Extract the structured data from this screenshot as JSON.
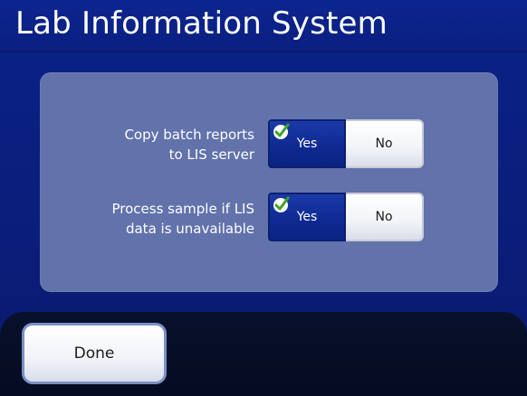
{
  "header": {
    "title": "Lab Information System"
  },
  "settings": {
    "rows": [
      {
        "label_line1": "Copy batch reports",
        "label_line2": "to LIS server",
        "yes_label": "Yes",
        "no_label": "No",
        "selected": "Yes"
      },
      {
        "label_line1": "Process sample if LIS",
        "label_line2": "data is unavailable",
        "yes_label": "Yes",
        "no_label": "No",
        "selected": "Yes"
      }
    ]
  },
  "footer": {
    "done_label": "Done"
  },
  "colors": {
    "selected_blue": "#0f2a93",
    "check_green": "#4caf2a",
    "panel": "#6272ab",
    "background": "#0b1f84"
  },
  "icons": {
    "selected_indicator": "checkmark-icon"
  }
}
